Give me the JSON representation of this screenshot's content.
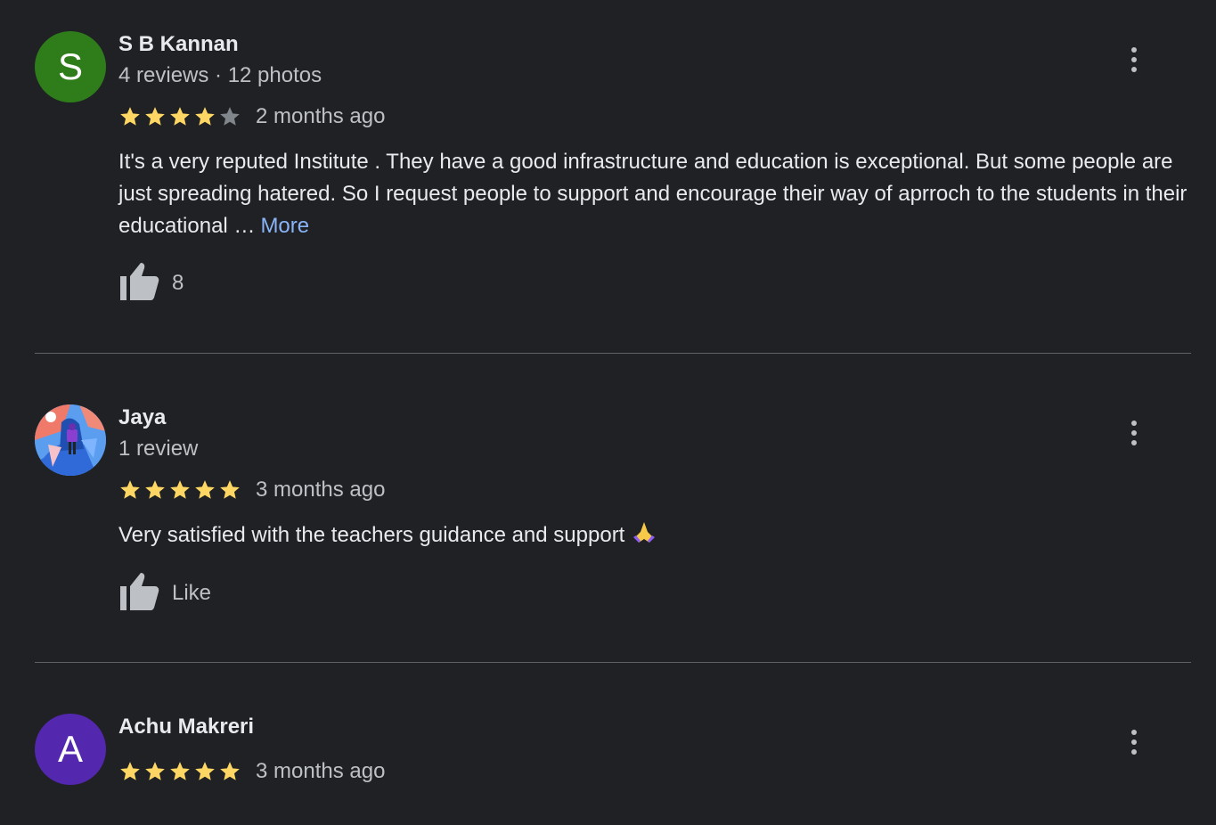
{
  "reviews": [
    {
      "avatar_letter": "S",
      "avatar_color": "#2e7d1a",
      "name": "S B Kannan",
      "meta": "4 reviews · 12 photos",
      "rating": 4,
      "time": "2 months ago",
      "text": "It's a very reputed Institute . They have a good infrastructure and education is exceptional. But some people are just spreading hatered. So I request people to support and encourage their way of aprroch to the students in their educational …",
      "more_label": "More",
      "like_label": "8"
    },
    {
      "avatar_letter": "",
      "avatar_color": "#4a8ee0",
      "name": "Jaya",
      "meta": "1 review",
      "rating": 5,
      "time": "3 months ago",
      "text": "Very satisfied with the teachers guidance and support",
      "emoji": "folded-hands-emoji",
      "like_label": "Like"
    },
    {
      "avatar_letter": "A",
      "avatar_color": "#5327ae",
      "name": "Achu Makreri",
      "rating": 5,
      "time": "3 months ago"
    }
  ],
  "colors": {
    "background": "#202124",
    "star_filled": "#fdd663",
    "star_empty": "#80868b",
    "link": "#8ab4f8",
    "divider": "#5f6368"
  }
}
